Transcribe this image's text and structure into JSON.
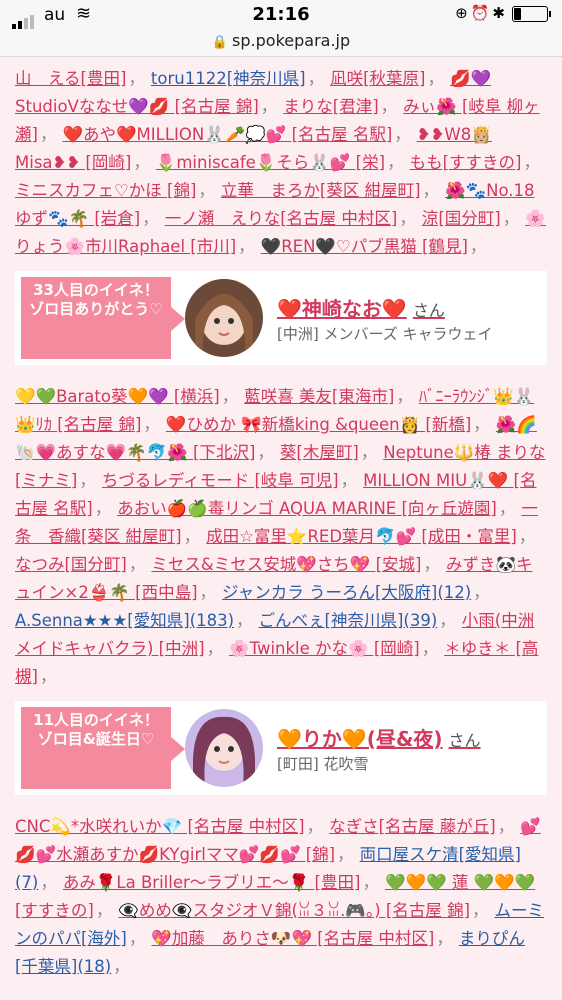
{
  "status": {
    "carrier": "au",
    "time": "21:16"
  },
  "url": "sp.pokepara.jp",
  "list1": [
    "山　える[豊田]",
    "toru1122[神奈川県]",
    "凪咲[秋葉原]",
    "💋💜StudioVななせ💜💋 [名古屋 錦]",
    "まりな[君津]",
    "みぃ🌺 [岐阜 柳ヶ瀬]",
    "❤️あや❤️MILLION🐰🥕💭💕 [名古屋 名駅]",
    "❥❥W8👸🏼Misa❥❥ [岡崎]",
    "🌷miniscafe🌷そら🐰💕 [栄]",
    "もも[すすきの]",
    "ミニスカフェ♡かほ [錦]",
    "立華　まろか[葵区 紺屋町]",
    "🌺🐾No.18ゆず🐾🌴 [岩倉]",
    "一ノ瀬　えりな[名古屋 中村区]",
    "涼[国分町]",
    "🌸りょう🌸市川Raphael [市川]",
    "🖤REN🖤♡パブ黒猫 [鶴見]"
  ],
  "list1_blue": [
    1
  ],
  "card1": {
    "ribbon": "33人目のイイネ！\nゾロ目ありがとう♡",
    "name": "❤️神崎なお❤️",
    "san": "さん",
    "shop": "[中洲] メンバーズ キャラウェイ"
  },
  "list2": [
    "💛💚Barato葵🧡💜 [横浜]",
    "藍咲喜 美友[東海市]",
    "ﾊﾞﾆｰﾗｳﾝｼﾞ👑🐰👑ﾘｶ [名古屋 錦]",
    "❤️ひめか 🎀新橋king &queen👸 [新橋]",
    "🌺🌈🐚💗あすな💗🌴🐬🌺 [下北沢]",
    "葵[木屋町]",
    "Neptune🔱椿 まりな [ミナミ]",
    "ちづるレディモード [岐阜 可児]",
    "MILLION MIU🐰❤️ [名古屋 名駅]",
    "あおい🍎🍏毒リンゴ AQUA MARINE [向ヶ丘遊園]",
    "一条　香織[葵区 紺屋町]",
    "成田☆富里⭐RED葉月🐬💕 [成田・富里]",
    "なつみ[国分町]",
    "ミセス&ミセス安城💖さち💖 [安城]",
    "みずき🐼キュイン×2👙🌴 [西中島]",
    "ジャンカラ うーろん[大阪府](12)",
    "A.Senna★★★[愛知県](183)",
    "ごんべぇ[神奈川県](39)",
    "小雨(中洲メイドキャバクラ) [中洲]",
    "🌸Twinkle かな🌸 [岡崎]",
    "＊ゆき＊ [高槻]"
  ],
  "list2_blue": [
    15,
    16,
    17
  ],
  "card2": {
    "ribbon": "11人目のイイネ！\nゾロ目&誕生日♡",
    "name": "🧡りか🧡(昼&夜)",
    "san": "さん",
    "shop": "[町田] 花吹雪"
  },
  "list3": [
    "CNC💫*水咲れいか💎 [名古屋 中村区]",
    "なぎさ[名古屋 藤が丘]",
    "💕💋💕水瀬あすか💋KYgirlママ💕💋💕 [錦]",
    "両口屋スケ清[愛知県](7)",
    "あみ🌹La Briller〜ラブリエ〜🌹 [豊田]",
    "💚🧡💚 蓮 💚🧡💚 [すすきの]",
    "👁‍🗨めめ👁‍🗨スタジオＶ錦(ꈍ３ꈍ.🎮。) [名古屋 錦]",
    "ムーミンのパパ[海外]",
    "💖加藤　ありさ🐶💖 [名古屋 中村区]",
    "まりぴん[千葉県](18)"
  ],
  "list3_blue": [
    3,
    7,
    9
  ]
}
